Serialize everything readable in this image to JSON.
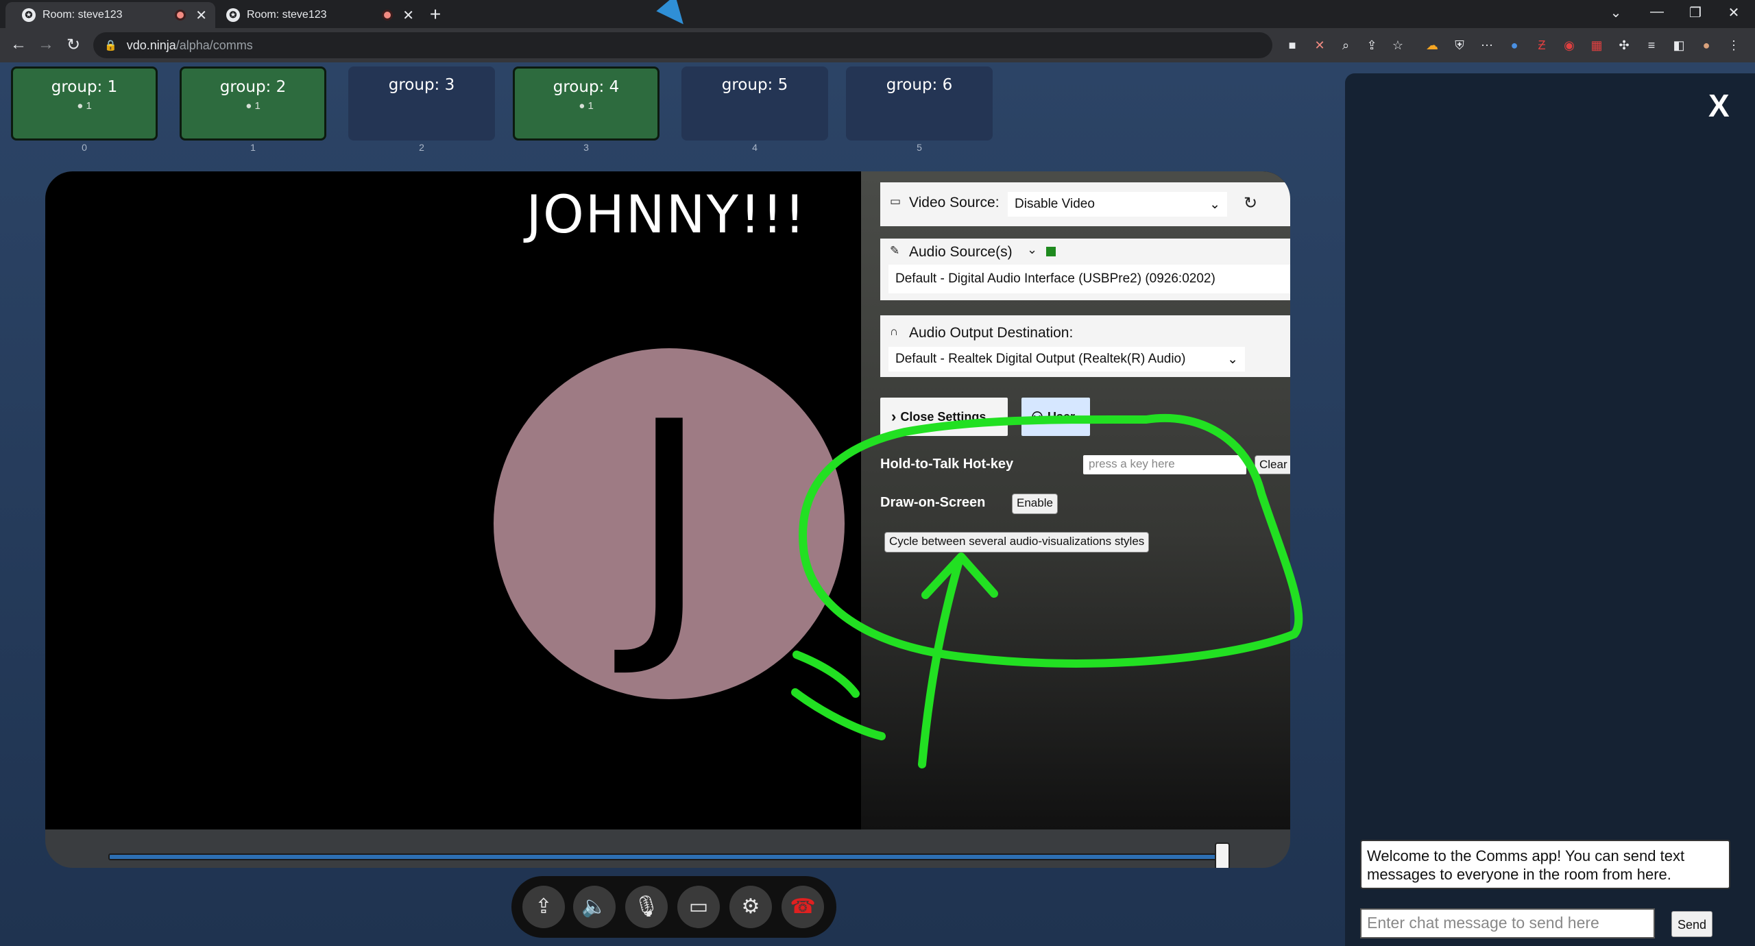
{
  "browser": {
    "tabs": [
      {
        "title": "Room: steve123",
        "active": true
      },
      {
        "title": "Room: steve123",
        "active": false
      }
    ],
    "url_host": "vdo.ninja",
    "url_path": "/alpha/comms"
  },
  "groups": [
    {
      "name": "group: 1",
      "count": "1",
      "index": "0",
      "active": true
    },
    {
      "name": "group: 2",
      "count": "1",
      "index": "1",
      "active": true
    },
    {
      "name": "group: 3",
      "count": "",
      "index": "2",
      "active": false
    },
    {
      "name": "group: 4",
      "count": "1",
      "index": "3",
      "active": true
    },
    {
      "name": "group: 5",
      "count": "",
      "index": "4",
      "active": false
    },
    {
      "name": "group: 6",
      "count": "",
      "index": "5",
      "active": false
    }
  ],
  "video": {
    "label": "JOHNNY!!!",
    "avatar_letter": "J"
  },
  "settings": {
    "video_source_label": "Video Source:",
    "video_source_value": "Disable Video",
    "audio_source_label": "Audio Source(s)",
    "audio_source_value": "Default - Digital Audio Interface (USBPre2) (0926:0202)",
    "audio_output_label": "Audio Output Destination:",
    "audio_output_value": "Default - Realtek Digital Output (Realtek(R) Audio)",
    "close_settings": "Close Settings",
    "user_button": "User",
    "hotkey_label": "Hold-to-Talk Hot-key",
    "hotkey_placeholder": "press a key here",
    "hotkey_clear": "Clear",
    "draw_label": "Draw-on-Screen",
    "draw_enable": "Enable",
    "cycle_viz": "Cycle between several audio-visualizations styles"
  },
  "chat": {
    "close": "X",
    "welcome": "Welcome to the Comms app! You can send text messages to everyone in the room from here.",
    "input_placeholder": "Enter chat message to send here",
    "send": "Send"
  },
  "colors": {
    "group_active": "#2d6b3e",
    "group_inactive": "#243554",
    "annotation": "#22e022",
    "avatar": "#9e7b84",
    "seekbar": "#2d6fb3"
  }
}
